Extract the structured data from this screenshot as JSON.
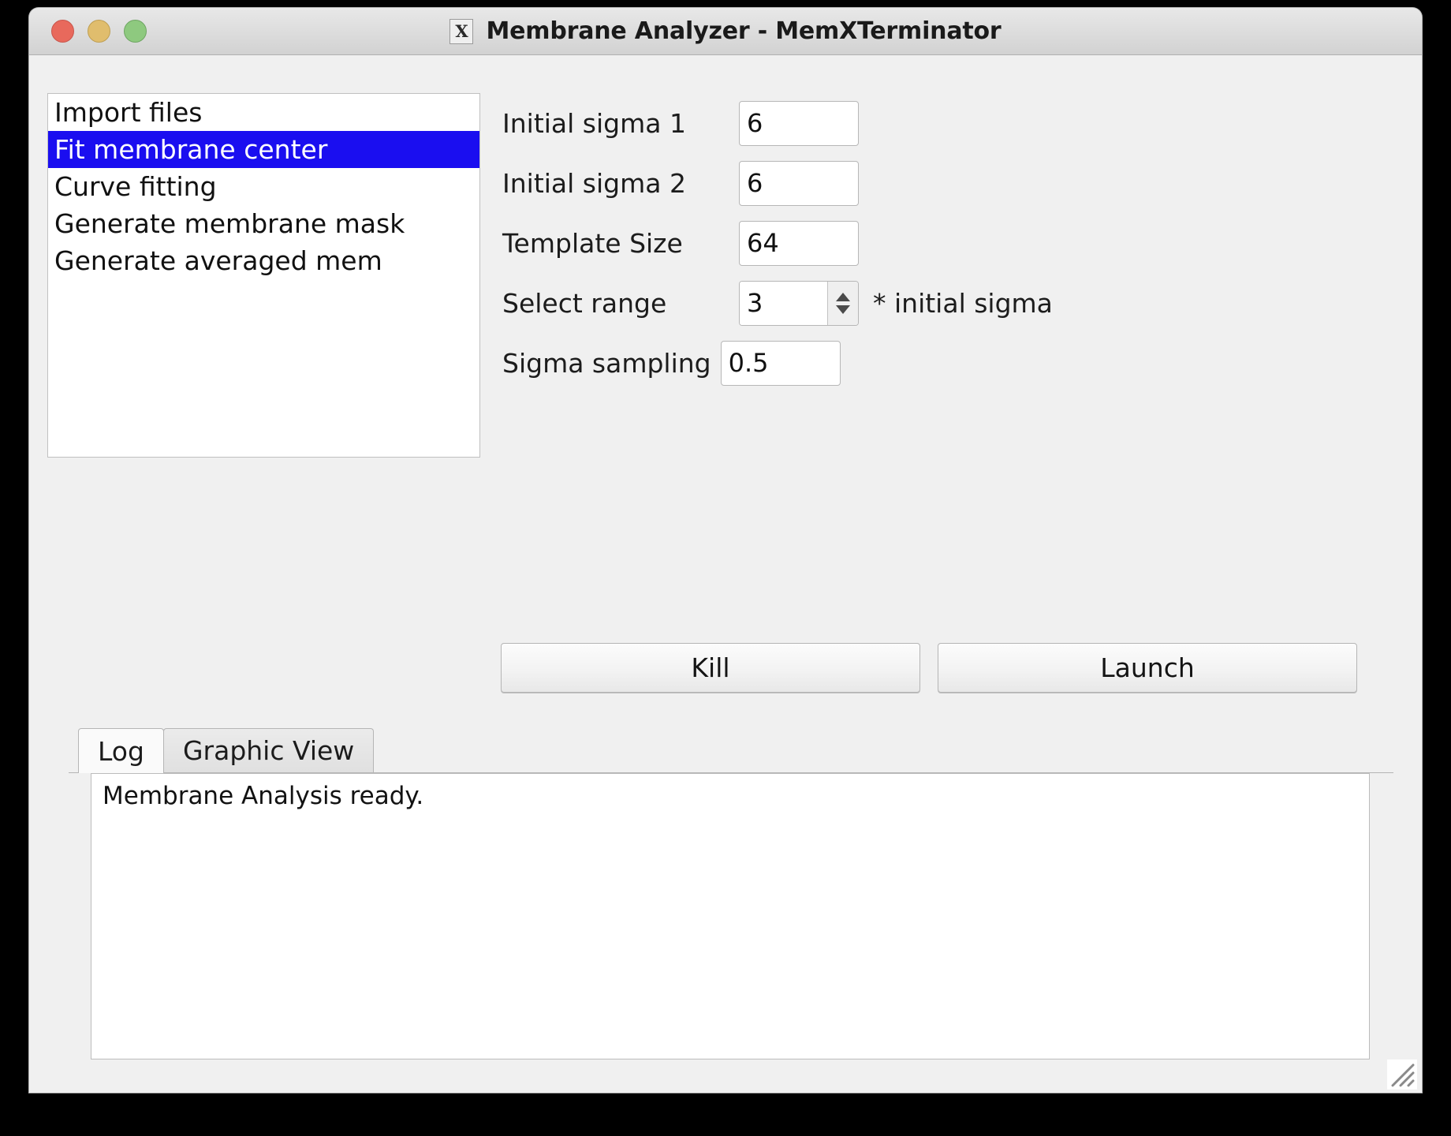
{
  "window": {
    "title": "Membrane Analyzer - MemXTerminator",
    "icon_name": "x11-window-icon",
    "icon_glyph": "X",
    "traffic_lights": [
      {
        "name": "close-button",
        "color": "#e8695c"
      },
      {
        "name": "minimize-button",
        "color": "#e0bd6d"
      },
      {
        "name": "maximize-button",
        "color": "#8ec97f"
      }
    ]
  },
  "task_list": {
    "selected_index": 1,
    "highlight_color": "#1a0ef0",
    "items": [
      {
        "label": "Import files"
      },
      {
        "label": "Fit membrane center"
      },
      {
        "label": "Curve fitting"
      },
      {
        "label": "Generate membrane mask"
      },
      {
        "label": "Generate averaged mem"
      }
    ]
  },
  "form": {
    "initial_sigma_1": {
      "label": "Initial sigma 1",
      "value": "6"
    },
    "initial_sigma_2": {
      "label": "Initial sigma 2",
      "value": "6"
    },
    "template_size": {
      "label": "Template Size",
      "value": "64"
    },
    "select_range": {
      "label": "Select range",
      "value": "3",
      "suffix": "* initial sigma"
    },
    "sigma_sampling": {
      "label": "Sigma sampling",
      "value": "0.5"
    }
  },
  "actions": {
    "kill_label": "Kill",
    "launch_label": "Launch"
  },
  "tabs": {
    "active": "Log",
    "items": [
      {
        "label": "Log"
      },
      {
        "label": "Graphic View"
      }
    ]
  },
  "log": {
    "text": "Membrane Analysis ready."
  }
}
